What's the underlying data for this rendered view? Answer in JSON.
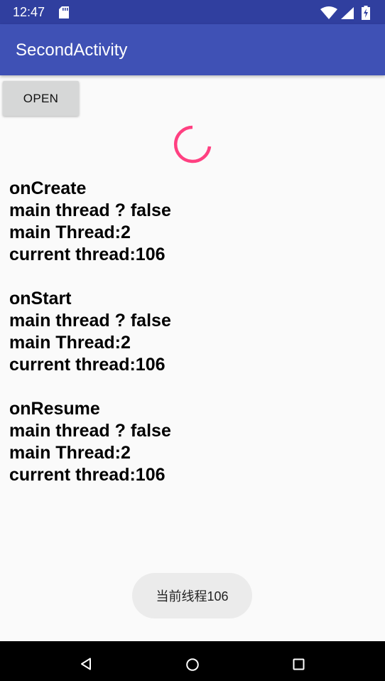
{
  "status_bar": {
    "time": "12:47",
    "icons": [
      "sd-card-icon",
      "wifi-icon",
      "signal-icon",
      "battery-charging-icon"
    ]
  },
  "app_bar": {
    "title": "SecondActivity",
    "color": "#3f51b5"
  },
  "open_button": {
    "label": "OPEN"
  },
  "progress": {
    "type": "indeterminate-spinner",
    "color": "#ff4081"
  },
  "log": {
    "blocks": [
      {
        "event": "onCreate",
        "main_thread_check": "main thread ? false",
        "main_thread_id": "main Thread:2",
        "current_thread": "current thread:106"
      },
      {
        "event": "onStart",
        "main_thread_check": "main thread ? false",
        "main_thread_id": "main Thread:2",
        "current_thread": "current thread:106"
      },
      {
        "event": "onResume",
        "main_thread_check": "main thread ? false",
        "main_thread_id": "main Thread:2",
        "current_thread": "current thread:106"
      }
    ]
  },
  "toast": {
    "message": "当前线程106"
  },
  "nav_bar": {
    "buttons": [
      "back-icon",
      "home-icon",
      "recents-icon"
    ]
  }
}
